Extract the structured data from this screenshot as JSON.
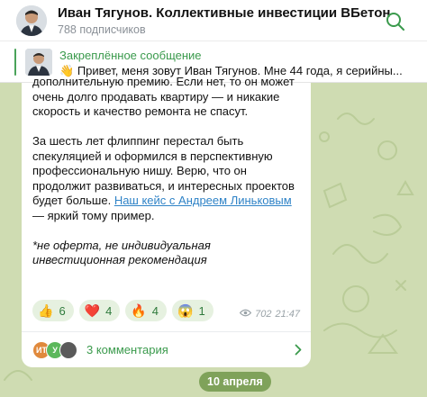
{
  "header": {
    "title": "Иван Тягунов. Коллективные инвестиции ВБетон",
    "subscribers": "788 подписчиков"
  },
  "pinned": {
    "label": "Закреплённое сообщение",
    "emoji": "👋",
    "text": "Привет, меня зовут Иван Тягунов. Мне 44 года, я серийны..."
  },
  "message": {
    "paragraph1": "дополнительную премию. Если нет, то он может очень долго продавать квартиру — и никакие скорость и качество ремонта не спасут.",
    "paragraph2_before": "За шесть лет флиппинг перестал быть спекуляцией и оформился в перспективную профессиональную нишу. Верю, что он продолжит развиваться, и интересных проектов будет больше. ",
    "paragraph2_link": "Наш кейс с Андреем Линьковым",
    "paragraph2_after": " — яркий тому пример.",
    "disclaimer": "*не оферта, не индивидуальная инвестиционная рекомендация",
    "reactions": [
      {
        "emoji": "👍",
        "count": "6"
      },
      {
        "emoji": "❤️",
        "count": "4"
      },
      {
        "emoji": "🔥",
        "count": "4"
      },
      {
        "emoji": "😱",
        "count": "1"
      }
    ],
    "views": "702",
    "time": "21:47",
    "comments": {
      "avatars": [
        "ИТ",
        "У",
        ""
      ],
      "label": "3 комментария"
    }
  },
  "date_pill": "10 апреля",
  "colors": {
    "accent": "#3a9a4c",
    "chat_bg": "#cfdcb2",
    "date_pill": "#7fa25a",
    "link": "#2f83c7"
  }
}
